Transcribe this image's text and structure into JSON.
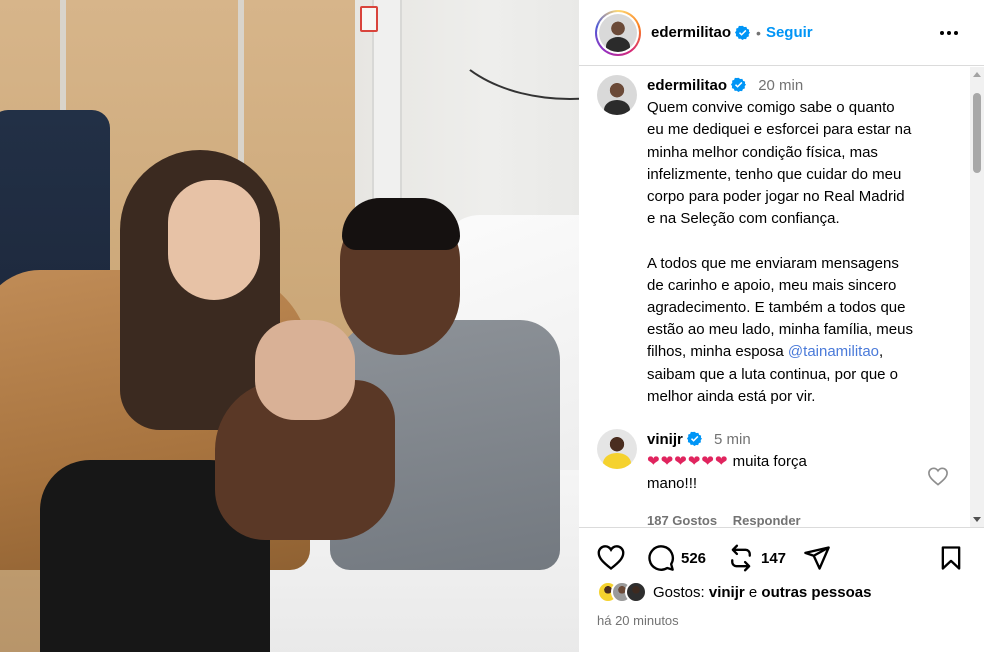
{
  "header": {
    "username": "edermilitao",
    "separator": "•",
    "follow_label": "Seguir"
  },
  "caption": {
    "username": "edermilitao",
    "time": "20 min",
    "lines": [
      "Quem convive comigo sabe o quanto",
      "eu me dediquei e esforcei para estar na",
      "minha melhor condição física, mas",
      "infelizmente, tenho que cuidar do meu",
      "corpo para poder jogar no Real Madrid",
      "e na Seleção com confiança.",
      "",
      "A todos que me enviaram mensagens",
      "de carinho e apoio, meu mais sincero",
      "agradecimento. E também a todos que",
      "estão ao meu lado, minha família, meus",
      "filhos, minha esposa"
    ],
    "mention": "@tainamilitao",
    "mention_after": ",",
    "tail_lines": [
      "saibam que a luta continua, por que o",
      "melhor ainda está por vir."
    ]
  },
  "comment": {
    "username": "vinijr",
    "time": "5 min",
    "hearts": "❤❤❤❤❤❤",
    "text_line1": " muita força",
    "text_line2": "mano!!!",
    "likes": "187 Gostos",
    "reply": "Responder"
  },
  "actions": {
    "comments_count": "526",
    "reposts_count": "147"
  },
  "likes": {
    "prefix": "Gostos:",
    "user": "vinijr",
    "middle": "e",
    "others": "outras pessoas"
  },
  "posted_ago": "há 20 minutos",
  "colors": {
    "accent_blue": "#0095f6",
    "verified_blue": "#0095f6",
    "heart_red": "#e0245e",
    "muted_text": "#737373"
  },
  "icons": {
    "header_more": "more-horizontal-icon",
    "verified": "verified-badge-icon",
    "like": "heart-outline-icon",
    "comment": "comment-bubble-icon",
    "repost": "repost-icon",
    "share": "send-icon",
    "save": "bookmark-icon"
  }
}
